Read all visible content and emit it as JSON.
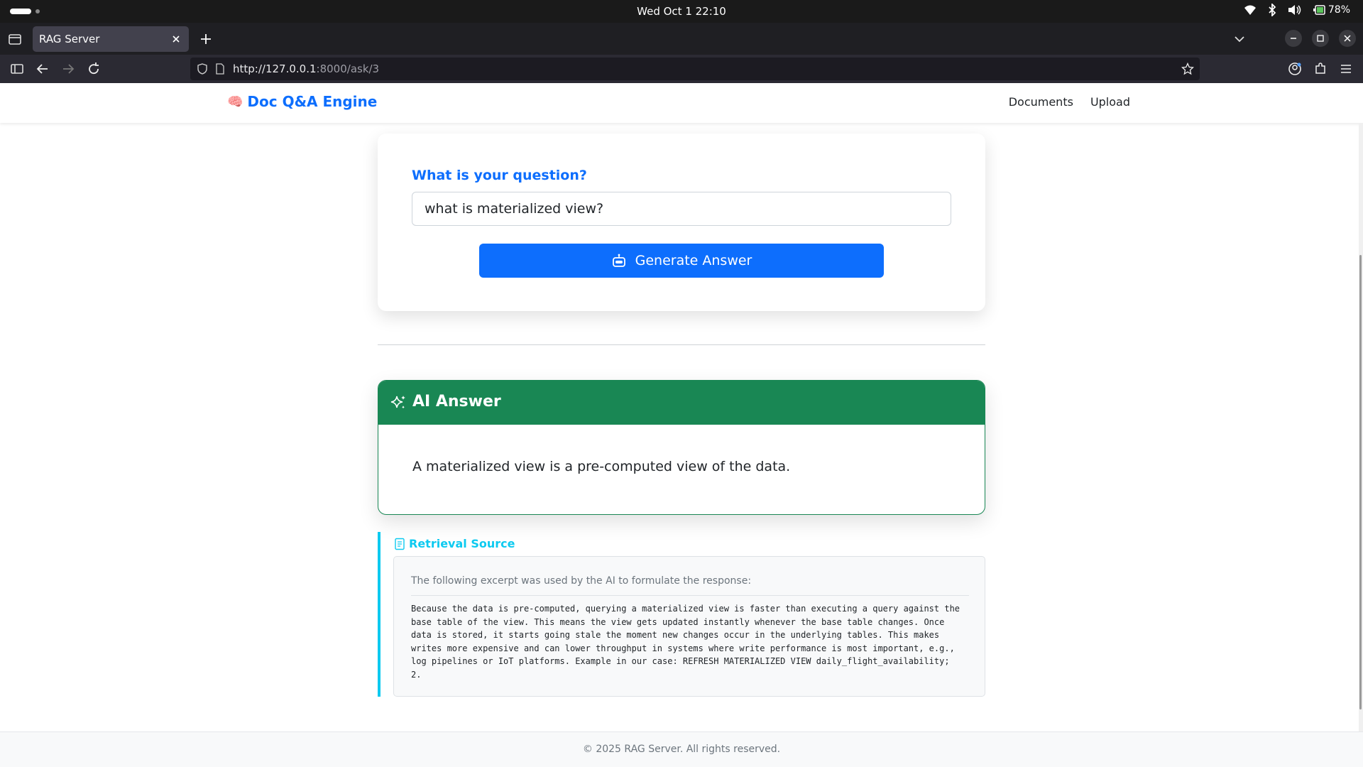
{
  "os": {
    "clock": "Wed Oct 1  22:10",
    "battery": "78%"
  },
  "browser": {
    "tab_title": "RAG Server",
    "url_host": "http://127.0.0.1",
    "url_path": ":8000/ask/3"
  },
  "header": {
    "brand_icon": "🧠",
    "brand_name": "Doc Q&A Engine",
    "nav": [
      "Documents",
      "Upload"
    ]
  },
  "ask": {
    "label": "What is your question?",
    "question_value": "what is materialized view?",
    "button_label": "Generate Answer"
  },
  "answer": {
    "title": "AI Answer",
    "text": "A materialized view is a pre-computed view of the data."
  },
  "source": {
    "title": "Retrieval Source",
    "intro": "The following excerpt was used by the AI to formulate the response:",
    "excerpt": "Because the data is pre-computed, querying a materialized view is faster than executing a query against the\nbase table of the view. This means the view gets updated instantly whenever the base table changes. Once\ndata is stored, it starts going stale the moment new changes occur in the underlying tables. This makes\nwrites more expensive and can lower throughput in systems where write performance is most important, e.g.,\nlog pipelines or IoT platforms. Example in our case: REFRESH MATERIALIZED VIEW daily_flight_availability;\n2."
  },
  "footer": {
    "text": "© 2025 RAG Server. All rights reserved."
  },
  "colors": {
    "primary": "#0d6efd",
    "success": "#198754",
    "info": "#0dcaf0"
  }
}
